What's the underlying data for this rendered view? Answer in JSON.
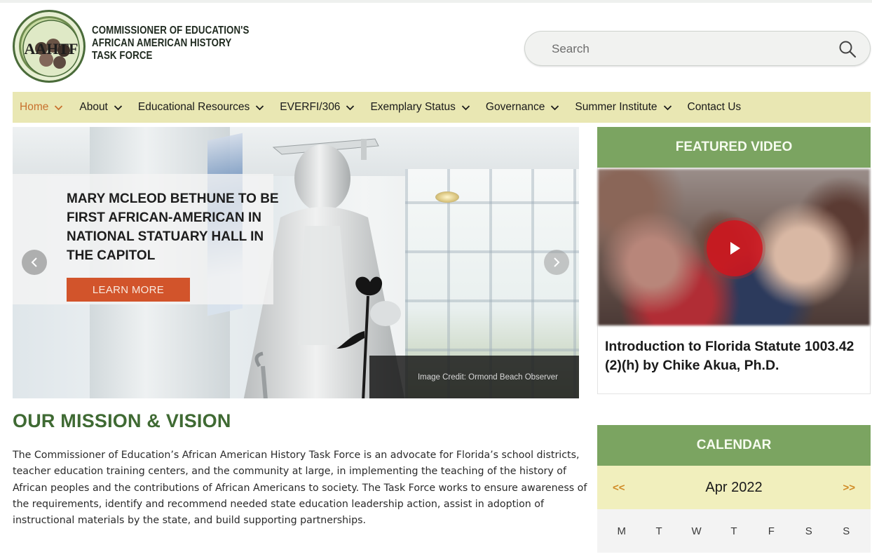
{
  "logo": {
    "acronym": "AAHTF",
    "title_lines": [
      "COMMISSIONER OF EDUCATION'S",
      "AFRICAN AMERICAN HISTORY",
      "TASK FORCE"
    ],
    "icon": "task-force-seal"
  },
  "search": {
    "placeholder": "Search",
    "icon": "search-icon"
  },
  "nav": {
    "items": [
      {
        "label": "Home",
        "has_dropdown": true,
        "active": true
      },
      {
        "label": "About",
        "has_dropdown": true
      },
      {
        "label": "Educational Resources",
        "has_dropdown": true
      },
      {
        "label": "EVERFI/306",
        "has_dropdown": true
      },
      {
        "label": "Exemplary Status",
        "has_dropdown": true
      },
      {
        "label": "Governance",
        "has_dropdown": true
      },
      {
        "label": "Summer Institute",
        "has_dropdown": true
      },
      {
        "label": "Contact Us",
        "has_dropdown": false
      }
    ]
  },
  "slider": {
    "headline": "MARY MCLEOD BETHUNE TO BE FIRST AFRICAN-AMERICAN IN NATIONAL STATUARY HALL IN THE CAPITOL",
    "button_label": "LEARN MORE",
    "credit": "Image Credit: Ormond Beach Observer"
  },
  "featured_video": {
    "heading": "FEATURED VIDEO",
    "title": "Introduction to Florida Statute 1003.42 (2)(h) by Chike Akua, Ph.D."
  },
  "mission": {
    "title": "OUR MISSION & VISION",
    "text": "The Commissioner of Education’s African American History Task Force is an advocate for Florida’s school districts, teacher education training centers, and the community at large, in implementing the teaching of the history of African peoples and the contributions of African Americans to society. The Task Force works to ensure awareness of the requirements, identify and recommend needed state education leadership action, assist in adoption of instructional materials by the state, and build supporting partnerships."
  },
  "calendar": {
    "heading": "CALENDAR",
    "prev": "<<",
    "month": "Apr 2022",
    "next": ">>",
    "weekdays": [
      "M",
      "T",
      "W",
      "T",
      "F",
      "S",
      "S"
    ]
  },
  "colors": {
    "green_header": "#7ba461",
    "nav_bg": "#e9e7b3",
    "accent_orange": "#c8712e",
    "cta_red": "#d2542b",
    "mission_green": "#3f6a33"
  }
}
